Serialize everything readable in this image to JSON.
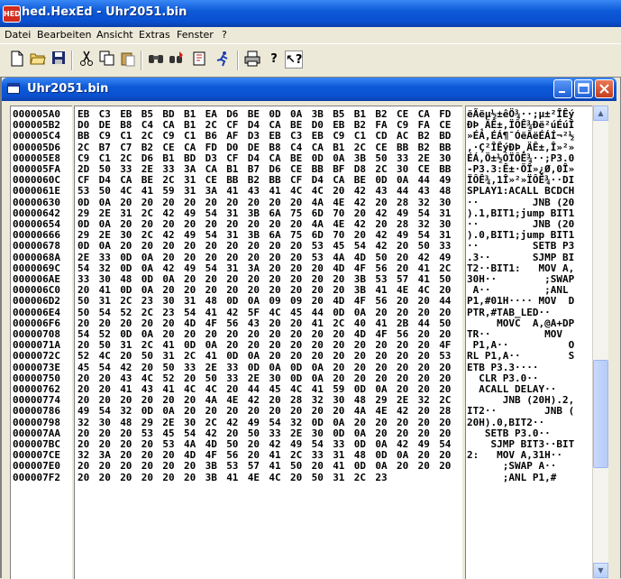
{
  "app": {
    "title": "hed.HexEd - Uhr2051.bin",
    "icon_label": "HED",
    "accent": "#0a5ad8"
  },
  "menu": [
    "Datei",
    "Bearbeiten",
    "Ansicht",
    "Extras",
    "Fenster",
    "?"
  ],
  "toolbar": [
    "new-file-icon",
    "open-folder-icon",
    "save-disk-icon",
    "cut-scissors-icon",
    "copy-icon",
    "paste-icon",
    "find-binoculars-icon",
    "replace-icon",
    "goto-runner-icon",
    "print-icon",
    "help-icon",
    "context-help-icon"
  ],
  "document": {
    "title": "Uhr2051.bin"
  },
  "rows": [
    {
      "addr": "000005A0",
      "bytes": "EB C3 EB B5 BD B1 EA D6 BE 0D 0A 3B B5 B1 B2 CE CA FD",
      "ascii": "ëÃëµ½±êÖ¾··;µ±²ÎÊý"
    },
    {
      "addr": "000005B2",
      "bytes": "D0 DE B8 C4 CA B1 2C CF D4 CA BE D0 EB B2 FA C9 FA CE",
      "ascii": "ÐÞ¸ÄÊ±,ÏÔÊ¾Ðë²úÉúÎ"
    },
    {
      "addr": "000005C4",
      "bytes": "BB C9 C1 2C C9 C1 B6 AF D3 EB C3 EB C9 C1 CD AC B2 BD",
      "ascii": "»ÉÁ,ÉÁ¶¯ÓëÃëÉÁÍ¬²½"
    },
    {
      "addr": "000005D6",
      "bytes": "2C B7 C7 B2 CE CA FD D0 DE B8 C4 CA B1 2C CE BB B2 BB",
      "ascii": ",·Ç²ÎÊýÐÞ¸ÄÊ±,Î»²»"
    },
    {
      "addr": "000005E8",
      "bytes": "C9 C1 2C D6 B1 BD D3 CF D4 CA BE 0D 0A 3B 50 33 2E 30",
      "ascii": "ÉÁ,Ö±½ÓÏÔÊ¾··;P3.0"
    },
    {
      "addr": "000005FA",
      "bytes": "2D 50 33 2E 33 3A CA B1 B7 D6 CE BB BF D8 2C 30 CE BB",
      "ascii": "-P3.3:Ê±·ÖÎ»¿Ø,0Î»"
    },
    {
      "addr": "0000060C",
      "bytes": "CF D4 CA BE 2C 31 CE BB B2 BB CF D4 CA BE 0D 0A 44 49",
      "ascii": "ÏÔÊ¾,1Î»²»ÏÔÊ¾··DI"
    },
    {
      "addr": "0000061E",
      "bytes": "53 50 4C 41 59 31 3A 41 43 41 4C 4C 20 42 43 44 43 48",
      "ascii": "SPLAY1:ACALL BCDCH"
    },
    {
      "addr": "00000630",
      "bytes": "0D 0A 20 20 20 20 20 20 20 20 20 4A 4E 42 20 28 32 30",
      "ascii": "··         JNB (20"
    },
    {
      "addr": "00000642",
      "bytes": "29 2E 31 2C 42 49 54 31 3B 6A 75 6D 70 20 42 49 54 31",
      "ascii": ").1,BIT1;jump BIT1"
    },
    {
      "addr": "00000654",
      "bytes": "0D 0A 20 20 20 20 20 20 20 20 20 4A 4E 42 20 28 32 30",
      "ascii": "··         JNB (20"
    },
    {
      "addr": "00000666",
      "bytes": "29 2E 30 2C 42 49 54 31 3B 6A 75 6D 70 20 42 49 54 31",
      "ascii": ").0,BIT1;jump BIT1"
    },
    {
      "addr": "00000678",
      "bytes": "0D 0A 20 20 20 20 20 20 20 20 20 53 45 54 42 20 50 33",
      "ascii": "··         SETB P3"
    },
    {
      "addr": "0000068A",
      "bytes": "2E 33 0D 0A 20 20 20 20 20 20 20 53 4A 4D 50 20 42 49",
      "ascii": ".3··       SJMP BI"
    },
    {
      "addr": "0000069C",
      "bytes": "54 32 0D 0A 42 49 54 31 3A 20 20 20 4D 4F 56 20 41 2C",
      "ascii": "T2··BIT1:   MOV A,"
    },
    {
      "addr": "000006AE",
      "bytes": "33 30 48 0D 0A 20 20 20 20 20 20 20 20 3B 53 57 41 50",
      "ascii": "30H··        ;SWAP"
    },
    {
      "addr": "000006C0",
      "bytes": "20 41 0D 0A 20 20 20 20 20 20 20 20 20 3B 41 4E 4C 20",
      "ascii": " A··         ;ANL "
    },
    {
      "addr": "000006D2",
      "bytes": "50 31 2C 23 30 31 48 0D 0A 09 09 20 4D 4F 56 20 20 44",
      "ascii": "P1,#01H···· MOV  D"
    },
    {
      "addr": "000006E4",
      "bytes": "50 54 52 2C 23 54 41 42 5F 4C 45 44 0D 0A 20 20 20 20",
      "ascii": "PTR,#TAB_LED··    "
    },
    {
      "addr": "000006F6",
      "bytes": "20 20 20 20 20 4D 4F 56 43 20 20 41 2C 40 41 2B 44 50",
      "ascii": "     MOVC  A,@A+DP"
    },
    {
      "addr": "00000708",
      "bytes": "54 52 0D 0A 20 20 20 20 20 20 20 20 20 4D 4F 56 20 20",
      "ascii": "TR··         MOV  "
    },
    {
      "addr": "0000071A",
      "bytes": "20 50 31 2C 41 0D 0A 20 20 20 20 20 20 20 20 20 20 4F",
      "ascii": " P1,A··          O"
    },
    {
      "addr": "0000072C",
      "bytes": "52 4C 20 50 31 2C 41 0D 0A 20 20 20 20 20 20 20 20 53",
      "ascii": "RL P1,A··        S"
    },
    {
      "addr": "0000073E",
      "bytes": "45 54 42 20 50 33 2E 33 0D 0A 0D 0A 20 20 20 20 20 20",
      "ascii": "ETB P3.3····      "
    },
    {
      "addr": "00000750",
      "bytes": "20 20 43 4C 52 20 50 33 2E 30 0D 0A 20 20 20 20 20 20",
      "ascii": "  CLR P3.0··      "
    },
    {
      "addr": "00000762",
      "bytes": "20 20 41 43 41 4C 4C 20 44 45 4C 41 59 0D 0A 20 20 20",
      "ascii": "  ACALL DELAY··   "
    },
    {
      "addr": "00000774",
      "bytes": "20 20 20 20 20 20 4A 4E 42 20 28 32 30 48 29 2E 32 2C",
      "ascii": "      JNB (20H).2,"
    },
    {
      "addr": "00000786",
      "bytes": "49 54 32 0D 0A 20 20 20 20 20 20 20 20 4A 4E 42 20 28",
      "ascii": "IT2··        JNB ("
    },
    {
      "addr": "00000798",
      "bytes": "32 30 48 29 2E 30 2C 42 49 54 32 0D 0A 20 20 20 20 20",
      "ascii": "20H).0,BIT2··     "
    },
    {
      "addr": "000007AA",
      "bytes": "20 20 20 53 45 54 42 20 50 33 2E 30 0D 0A 20 20 20 20",
      "ascii": "   SETB P3.0··    "
    },
    {
      "addr": "000007BC",
      "bytes": "20 20 20 20 53 4A 4D 50 20 42 49 54 33 0D 0A 42 49 54",
      "ascii": "    SJMP BIT3··BIT"
    },
    {
      "addr": "000007CE",
      "bytes": "32 3A 20 20 20 4D 4F 56 20 41 2C 33 31 48 0D 0A 20 20",
      "ascii": "2:   MOV A,31H··  "
    },
    {
      "addr": "000007E0",
      "bytes": "20 20 20 20 20 20 3B 53 57 41 50 20 41 0D 0A 20 20 20",
      "ascii": "      ;SWAP A··   "
    },
    {
      "addr": "000007F2",
      "bytes": "20 20 20 20 20 20 3B 41 4E 4C 20 50 31 2C 23",
      "ascii": "      ;ANL P1,#"
    }
  ]
}
